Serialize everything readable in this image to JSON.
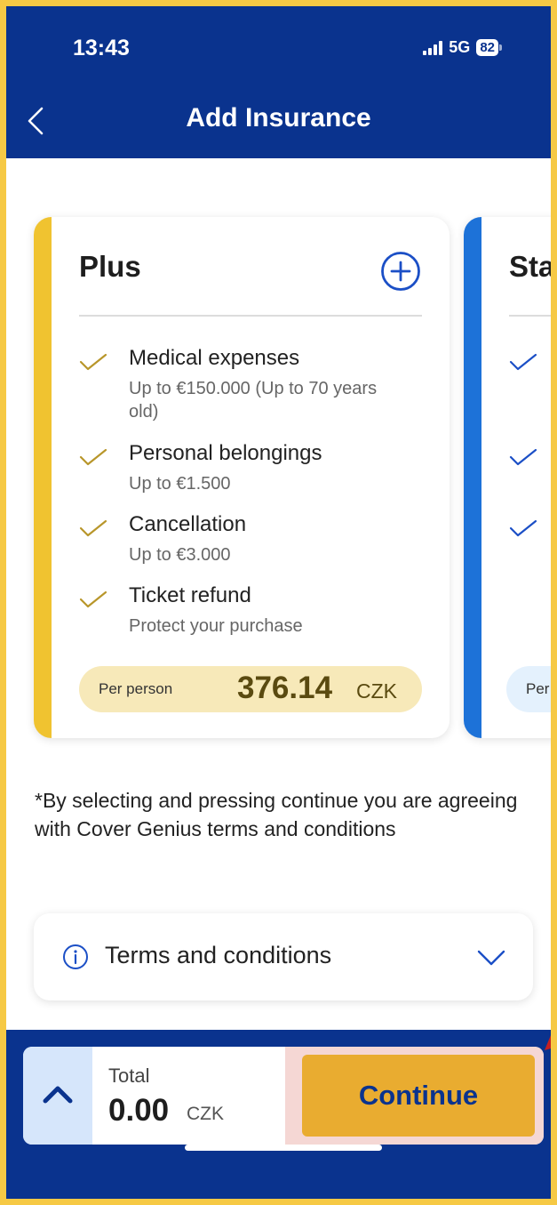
{
  "status": {
    "time": "13:43",
    "network": "5G",
    "battery": "82"
  },
  "header": {
    "title": "Add Insurance"
  },
  "plans": [
    {
      "name": "Plus",
      "features": [
        {
          "name": "Medical expenses",
          "desc": "Up to €150.000 (Up to 70 years old)"
        },
        {
          "name": "Personal belongings",
          "desc": "Up to €1.500"
        },
        {
          "name": "Cancellation",
          "desc": "Up to €3.000"
        },
        {
          "name": "Ticket refund",
          "desc": "Protect your purchase"
        }
      ],
      "price_label": "Per person",
      "price": "376.14",
      "currency": "CZK"
    },
    {
      "name": "Sta",
      "price_label": "Per"
    }
  ],
  "disclaimer": "*By selecting and pressing continue you are agreeing with Cover Genius terms and conditions",
  "terms": {
    "label": "Terms and conditions"
  },
  "footer": {
    "total_label": "Total",
    "total_value": "0.00",
    "currency": "CZK",
    "continue_label": "Continue"
  },
  "colors": {
    "brand_blue": "#0a338e",
    "plus_accent": "#f0c330",
    "standard_accent": "#1d72d8",
    "continue_button": "#e9ac30"
  }
}
